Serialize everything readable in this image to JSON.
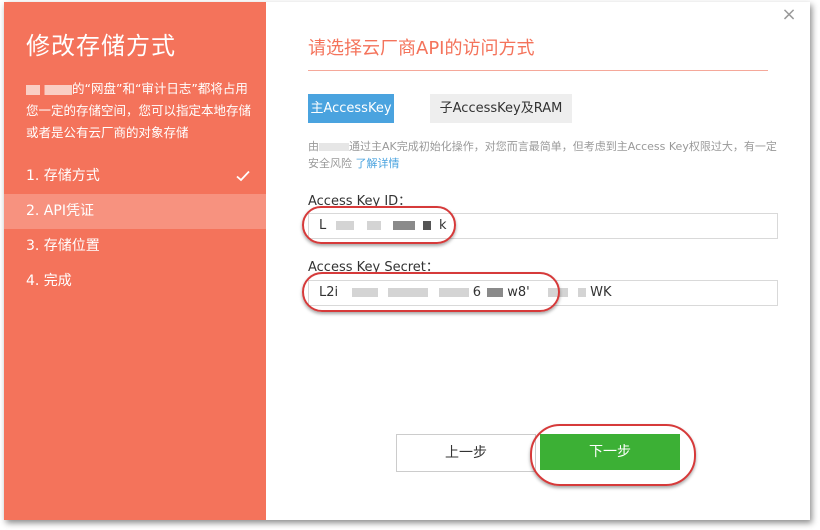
{
  "sidebar": {
    "title": "修改存储方式",
    "desc_part1": "的“网盘”和“审计日志”都将占用您一定的存储空间，您可以指定本地存储或者是公有云厂商的对象存储",
    "steps": [
      {
        "label": "1. 存储方式",
        "done": true
      },
      {
        "label": "2. API凭证",
        "active": true
      },
      {
        "label": "3. 存储位置"
      },
      {
        "label": "4. 完成"
      }
    ]
  },
  "main": {
    "title": "请选择云厂商API的访问方式",
    "tabs": [
      {
        "label": "主AccessKey",
        "selected": true
      },
      {
        "label": "子AccessKey及RAM",
        "selected": false
      }
    ],
    "note_prefix": "由",
    "note_text": "通过主AK完成初始化操作，对您而言最简单，但考虑到主Access Key权限过大，有一定安全风险",
    "note_link": "了解详情",
    "access_key_id_label": "Access Key ID：",
    "access_key_id_visible_start": "L",
    "access_key_id_visible_end": "k",
    "access_key_secret_label": "Access Key Secret：",
    "access_key_secret_start": "L2i",
    "access_key_secret_mid1": "6",
    "access_key_secret_mid2": "w8'",
    "access_key_secret_end": "WK",
    "prev_button": "上一步",
    "next_button": "下一步",
    "close_symbol": "×"
  },
  "colors": {
    "sidebar_bg": "#f4735b",
    "active_step_bg": "#f7927f",
    "accent": "#f4735b",
    "tab_selected": "#4aa3df",
    "next_button": "#3cb035",
    "annotation_ring": "#d63a3a"
  },
  "icons": {
    "check": "check-icon",
    "close": "close-icon"
  }
}
